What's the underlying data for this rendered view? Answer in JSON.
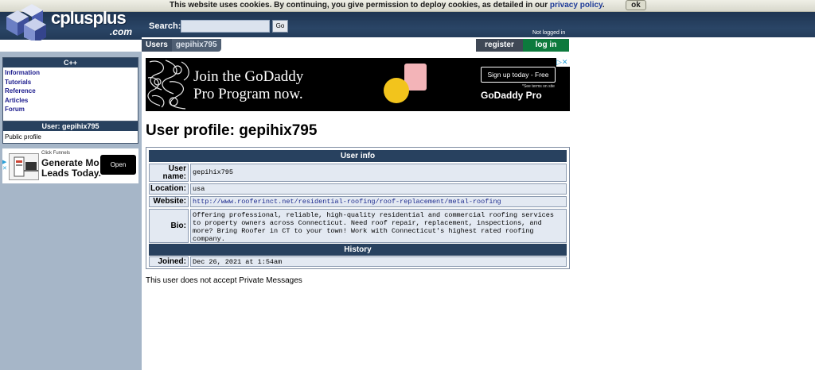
{
  "cookie_bar": {
    "text": "This website uses cookies. By continuing, you give permission to deploy cookies, as detailed in our",
    "link": "privacy policy",
    "ok_label": "ok"
  },
  "header": {
    "logo_name": "cplusplus",
    "logo_tld": ".com",
    "search_label": "Search:",
    "search_value": "",
    "go_label": "Go",
    "login_status": "Not logged in"
  },
  "breadcrumb": {
    "section": "Users",
    "current": "gepihix795"
  },
  "auth": {
    "register_label": "register",
    "login_label": "log in"
  },
  "sidebar": {
    "cpp_title": "C++",
    "items": [
      {
        "label": "Information"
      },
      {
        "label": "Tutorials"
      },
      {
        "label": "Reference"
      },
      {
        "label": "Articles"
      },
      {
        "label": "Forum"
      }
    ],
    "user_title": "User: gepihix795",
    "user_items": [
      {
        "label": "Public profile"
      }
    ]
  },
  "side_ad": {
    "brand": "Click Funnels",
    "headline_1": "Generate Mo",
    "headline_2": "Leads Today.",
    "open_label": "Open"
  },
  "banner_ad": {
    "line1": "Join the GoDaddy",
    "line2": "Pro Program now.",
    "cta": "Sign up today - Free",
    "terms": "*See terms on site",
    "logo": "GoDaddy Pro"
  },
  "profile": {
    "title": "User profile: gepihix795",
    "user_info_heading": "User info",
    "history_heading": "History",
    "fields": {
      "username_label": "User name:",
      "username_value": "gepihix795",
      "location_label": "Location:",
      "location_value": "usa",
      "website_label": "Website:",
      "website_value": "http://www.rooferinct.net/residential-roofing/roof-replacement/metal-roofing",
      "bio_label": "Bio:",
      "bio_value": "Offering professional, reliable, high-quality residential and commercial roofing services to property owners across Connecticut. Need roof repair, replacement, inspections, and more? Bring Roofer in CT to your town! Work with Connecticut's highest rated roofing company.",
      "joined_label": "Joined:",
      "joined_value": "Dec 26, 2021 at 1:54am"
    },
    "pm_note": "This user does not accept Private Messages"
  },
  "colors": {
    "header_bg": "#223a58",
    "sidebar_bg": "#a6b6c8",
    "section_head": "#28415f",
    "login_green": "#0d7a3d",
    "link_blue": "#1b1b8d"
  }
}
